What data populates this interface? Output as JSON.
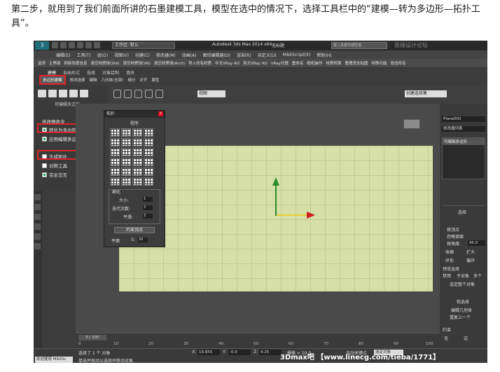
{
  "caption": "第二步，就用到了我们前面所讲的石墨建模工具，模型在选中的情况下，选择工具栏中的“建模—转为多边形—拓扑工具”。",
  "titlebar": {
    "workspace": "工作区: 默认",
    "app_title": "Autodesk 3ds Max  2014 x64",
    "doc_title": "无标题",
    "search_placeholder": "键入关键字或短语",
    "watermark": "思缘设计论坛"
  },
  "menu": [
    "编辑(E)",
    "工具(T)",
    "组(G)",
    "视图(V)",
    "创建(C)",
    "修改器(M)",
    "动画(A)",
    "图形编辑器(D)",
    "渲染(R)",
    "自定义(U)",
    "MAXScript(X)",
    "帮助(H)"
  ],
  "toolbar2": [
    "选项",
    "主界面",
    "刷新场景信息",
    "清空材质球(Std)",
    "清空材质球(VR)",
    "清空材质球(Arch)",
    "导入所有材质",
    "中文VRay AO",
    "英文VRay AO",
    "VRay代理",
    "重命名",
    "随机操作",
    "材质转换",
    "整理丢失贴图",
    "特殊功能",
    "修改所有"
  ],
  "ribbon": {
    "tabs": [
      "建模",
      "自由形式",
      "选择",
      "对象绘制",
      "填充"
    ],
    "subtabs": [
      "多边形建模",
      "修改选择",
      "编辑",
      "几何体(全部)",
      "细分",
      "对齐",
      "属性"
    ],
    "dropdown_title": "可编辑多边形",
    "items": {
      "ns_label": "修改器命令",
      "convert": "转化为多边形",
      "apply_mode": "应用编辑多边形模式",
      "generate_topology": "生成拓扑",
      "symmetry": "对称工具",
      "complete_interact": "完全交互"
    }
  },
  "viewport": {
    "view_select": "视图",
    "selection_set": "创建选择集"
  },
  "palette": {
    "title": "拓扑",
    "section_patterns": "程序",
    "section_subdivide": "细化",
    "size_label": "大小:",
    "size_value": "1",
    "iter_label": "迭代次数:",
    "iter_value": "3",
    "smooth_label": "平滑:",
    "smooth_value": "3",
    "constrain_button": "约束顶点",
    "plane_label": "平面",
    "s_label": "S:",
    "s_value": "26"
  },
  "right_panel": {
    "object_name": "Plane002",
    "modifier_list": "修改器列表",
    "stack_item": "可编辑多边形",
    "sel_title": "选择",
    "by_vertex": "按顶点",
    "ignore_back": "忽略背面",
    "by_angle": "按角度:",
    "angle_value": "45.0",
    "shrink": "收缩",
    "grow": "扩大",
    "ring": "环形",
    "loop": "循环",
    "preview_sel": "预览选择",
    "disabled": "禁用",
    "subobj": "子对象",
    "multi": "多个",
    "whole_obj": "选定整个对象",
    "soft_sel": "软选择",
    "edit_geo": "编辑几何体",
    "repeat_last": "重复上一个",
    "constraint": "约束",
    "none": "无",
    "edge": "边"
  },
  "timeline": {
    "slider": "0 / 100",
    "ticks": [
      "0",
      "10",
      "20",
      "30",
      "40",
      "50",
      "60",
      "70",
      "80",
      "90",
      "100"
    ]
  },
  "status": {
    "selected": "选择了 1 个 对象",
    "hint": "单击并拖动以选择并移动对象",
    "x_label": "X:",
    "x_value": "19.655",
    "y_label": "Y:",
    "y_value": "-0.0",
    "z_label": "Z:",
    "z_value": "4.25",
    "grid": "栅格 = 10.0",
    "auto_key": "自动关键点",
    "selected_obj": "选定对象",
    "welcome": "欢迎使用 MAXSc",
    "big_watermark": "3Dmax吧 【www.linecg.com/tieba/1771】"
  },
  "colors": {
    "highlight_red": "#e0232a",
    "plane_green": "#d6dfa8",
    "y_axis": "#2c8c2c",
    "x_axis_arrow": "#d0201f"
  }
}
